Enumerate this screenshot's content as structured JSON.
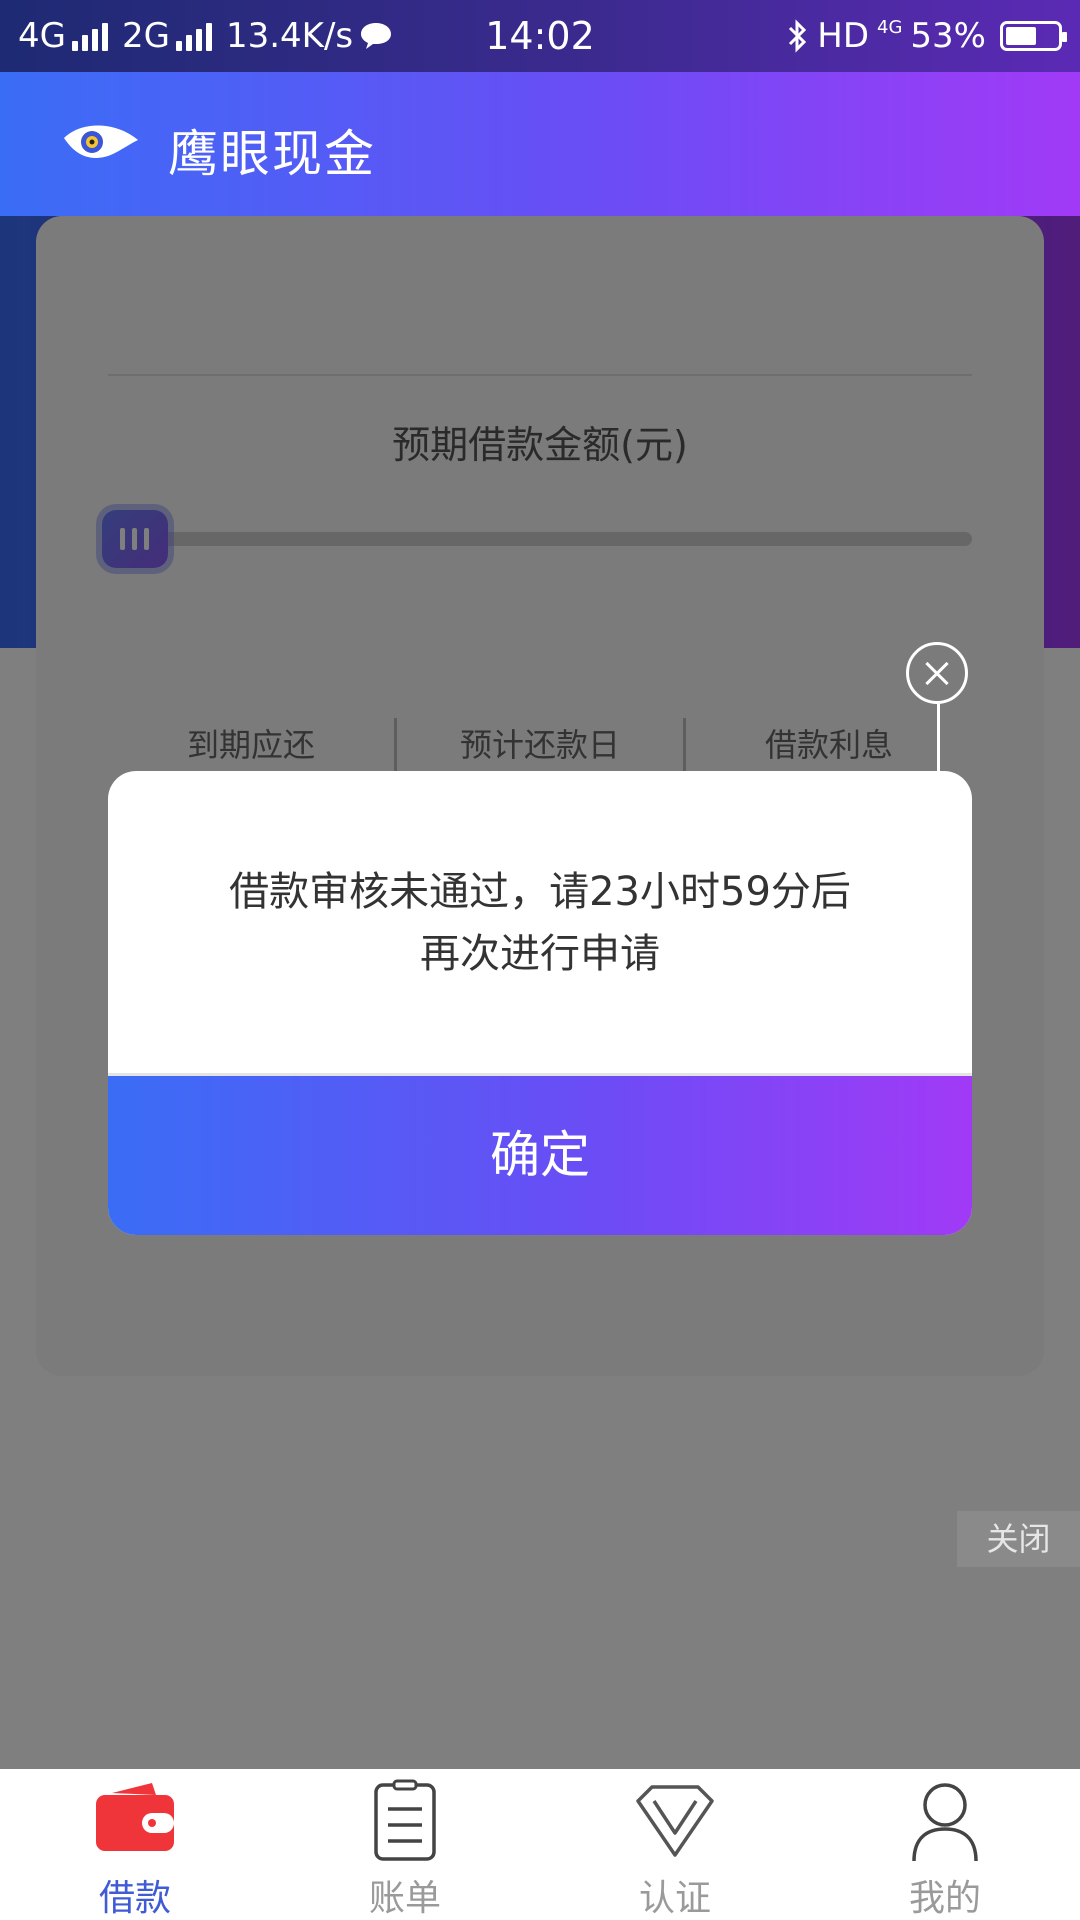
{
  "status_bar": {
    "network1": "4G",
    "network2": "2G",
    "speed": "13.4K/s",
    "time": "14:02",
    "hd": "HD",
    "net_small": "4G",
    "battery": "53%"
  },
  "header": {
    "title": "鹰眼现金"
  },
  "card": {
    "amount_label": "预期借款金额(元)",
    "slider_level": 0,
    "stats": [
      "到期应还",
      "预计还款日",
      "借款利息"
    ]
  },
  "dialog": {
    "message_line1": "借款审核未通过，请23小时59分后",
    "message_line2": "再次进行申请",
    "confirm_label": "确定"
  },
  "side_close": {
    "label": "关闭"
  },
  "tabbar": {
    "items": [
      {
        "label": "借款",
        "icon": "wallet-icon",
        "active": true
      },
      {
        "label": "账单",
        "icon": "bill-icon",
        "active": false
      },
      {
        "label": "认证",
        "icon": "diamond-icon",
        "active": false
      },
      {
        "label": "我的",
        "icon": "user-icon",
        "active": false
      }
    ]
  },
  "colors": {
    "brand_gradient_start": "#3a6df6",
    "brand_gradient_end": "#a13af7",
    "active_tab": "#3f5bd6",
    "wallet_red": "#f0353a"
  }
}
